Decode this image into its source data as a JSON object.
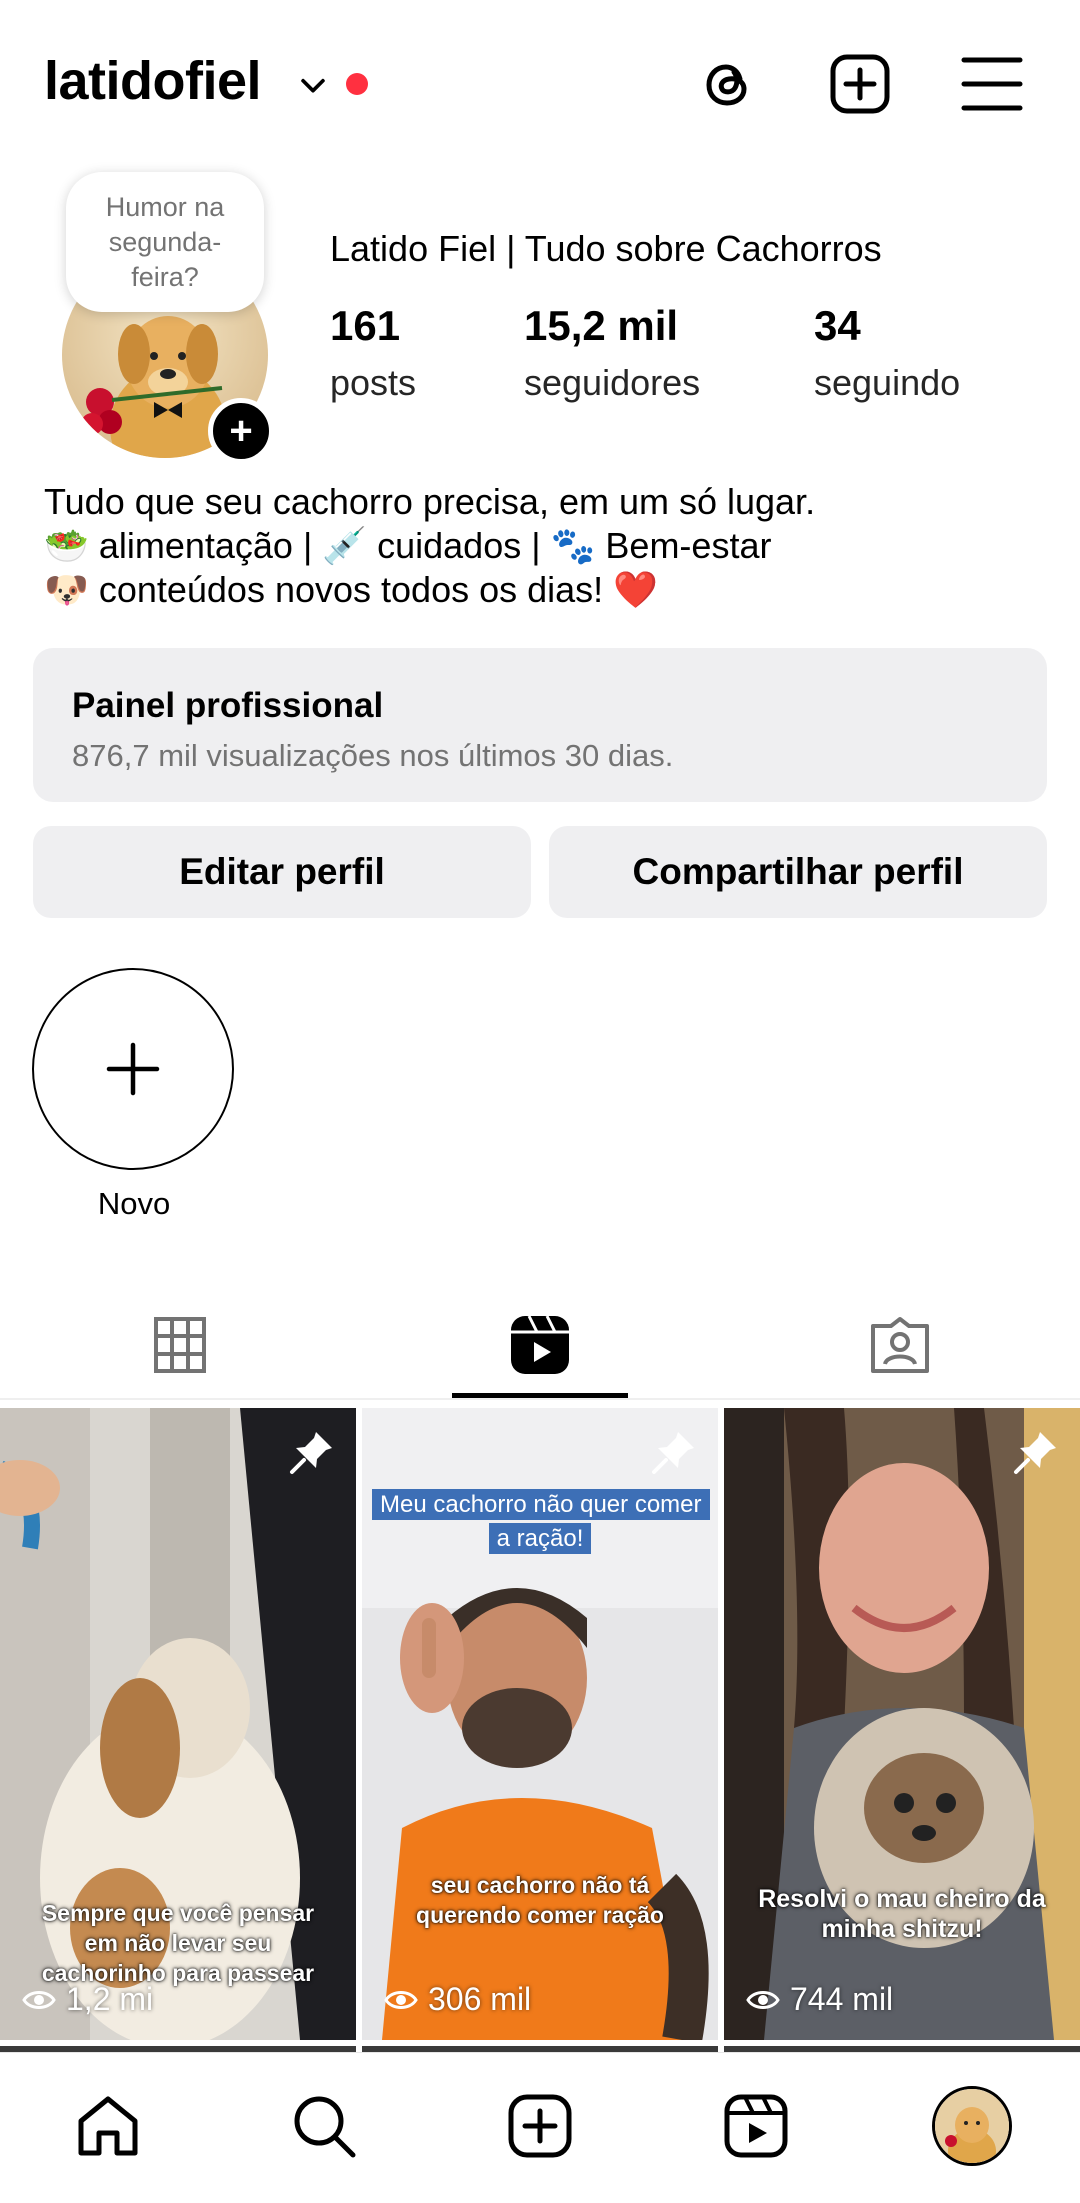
{
  "header": {
    "username": "latidofiel",
    "icons": [
      "chevron-down-icon",
      "threads-icon",
      "add-post-icon",
      "menu-icon"
    ],
    "notification_dot_color": "#ff3040"
  },
  "profile": {
    "note": "Humor na segunda-feira?",
    "full_name": "Latido Fiel | Tudo sobre Cachorros",
    "stats": [
      {
        "value": "161",
        "label": "posts"
      },
      {
        "value": "15,2 mil",
        "label": "seguidores"
      },
      {
        "value": "34",
        "label": "seguindo"
      }
    ],
    "bio": [
      "Tudo que seu cachorro precisa, em um só lugar.",
      "🥗 alimentação | 💉 cuidados | 🐾 Bem-estar",
      "🐶 conteúdos novos todos os dias! ❤️"
    ]
  },
  "dashboard": {
    "title": "Painel profissional",
    "subtitle": "876,7 mil visualizações nos últimos 30 dias."
  },
  "buttons": {
    "edit": "Editar perfil",
    "share": "Compartilhar perfil"
  },
  "highlights": {
    "new_label": "Novo"
  },
  "tabs": [
    {
      "icon": "grid-icon",
      "active": false
    },
    {
      "icon": "reels-icon",
      "active": true
    },
    {
      "icon": "tagged-icon",
      "active": false
    }
  ],
  "reels": [
    {
      "caption": "Sempre que você pensar em não levar seu cachorinho para passear",
      "views": "1,2 mi",
      "pinned": true
    },
    {
      "top_caption": "Meu cachorro não quer comer a ração!",
      "caption": "seu cachorro não tá querendo comer ração",
      "views": "306 mil",
      "pinned": true
    },
    {
      "caption": "Resolvi o mau cheiro da minha shitzu!",
      "views": "744 mil",
      "pinned": true
    }
  ],
  "bottom_nav": [
    "home-icon",
    "search-icon",
    "create-icon",
    "reels-icon",
    "profile-avatar"
  ]
}
